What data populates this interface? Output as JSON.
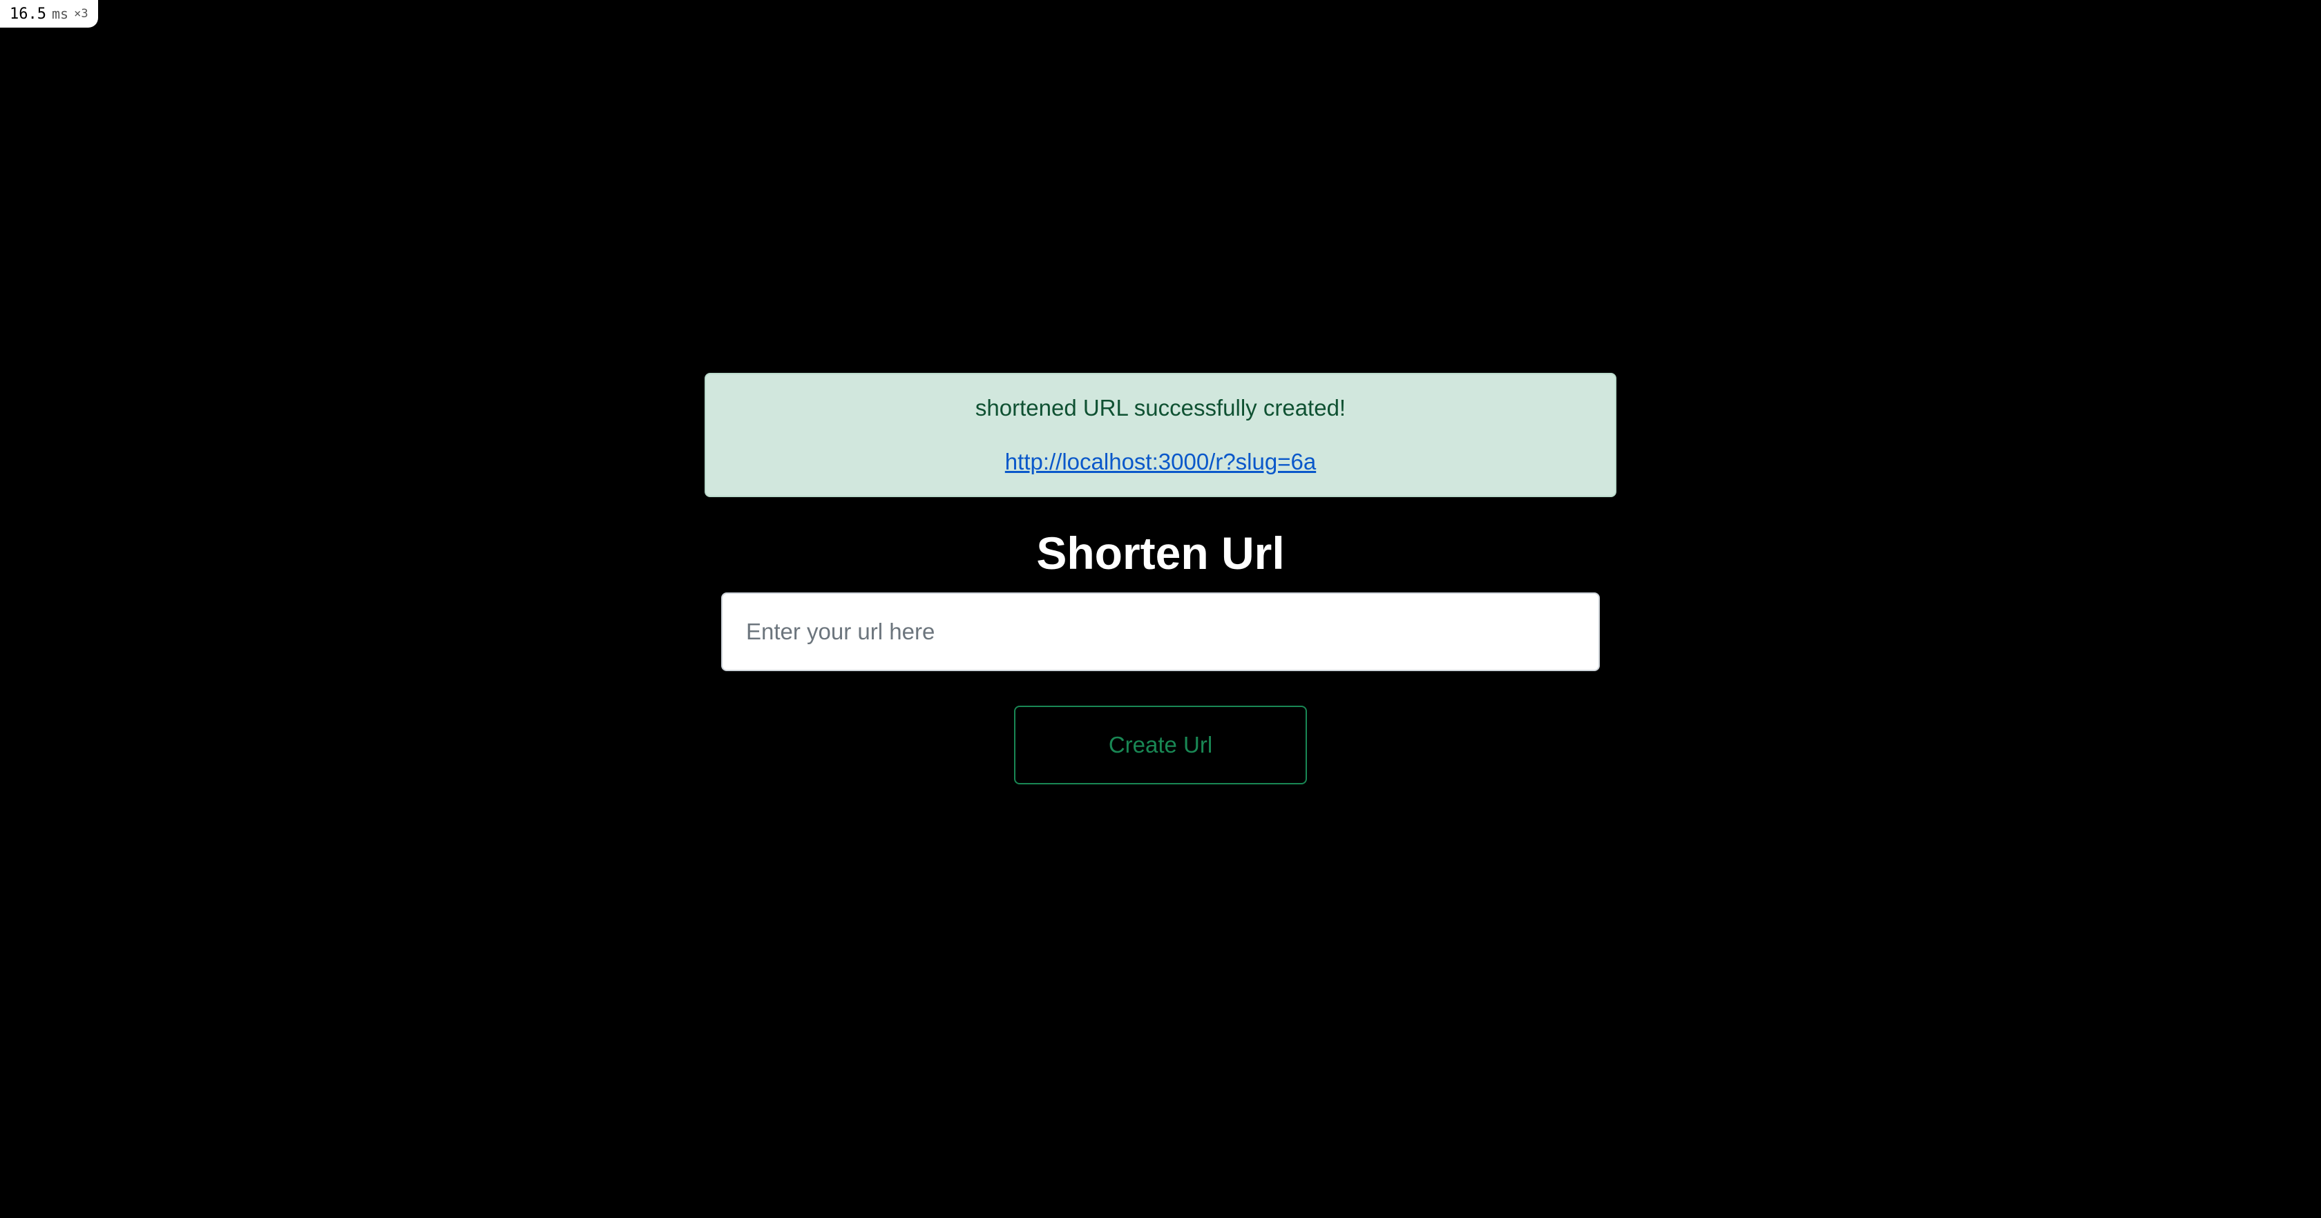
{
  "perf": {
    "value": "16.5",
    "unit": "ms",
    "multiplier": "×3"
  },
  "alert": {
    "message": "shortened URL successfully created!",
    "link_text": "http://localhost:3000/r?slug=6a"
  },
  "form": {
    "title": "Shorten Url",
    "input_placeholder": "Enter your url here",
    "input_value": "",
    "button_label": "Create Url"
  },
  "colors": {
    "background": "#000000",
    "alert_bg": "#d1e7dd",
    "alert_text": "#0f5132",
    "link": "#0a58ca",
    "accent": "#198754"
  }
}
